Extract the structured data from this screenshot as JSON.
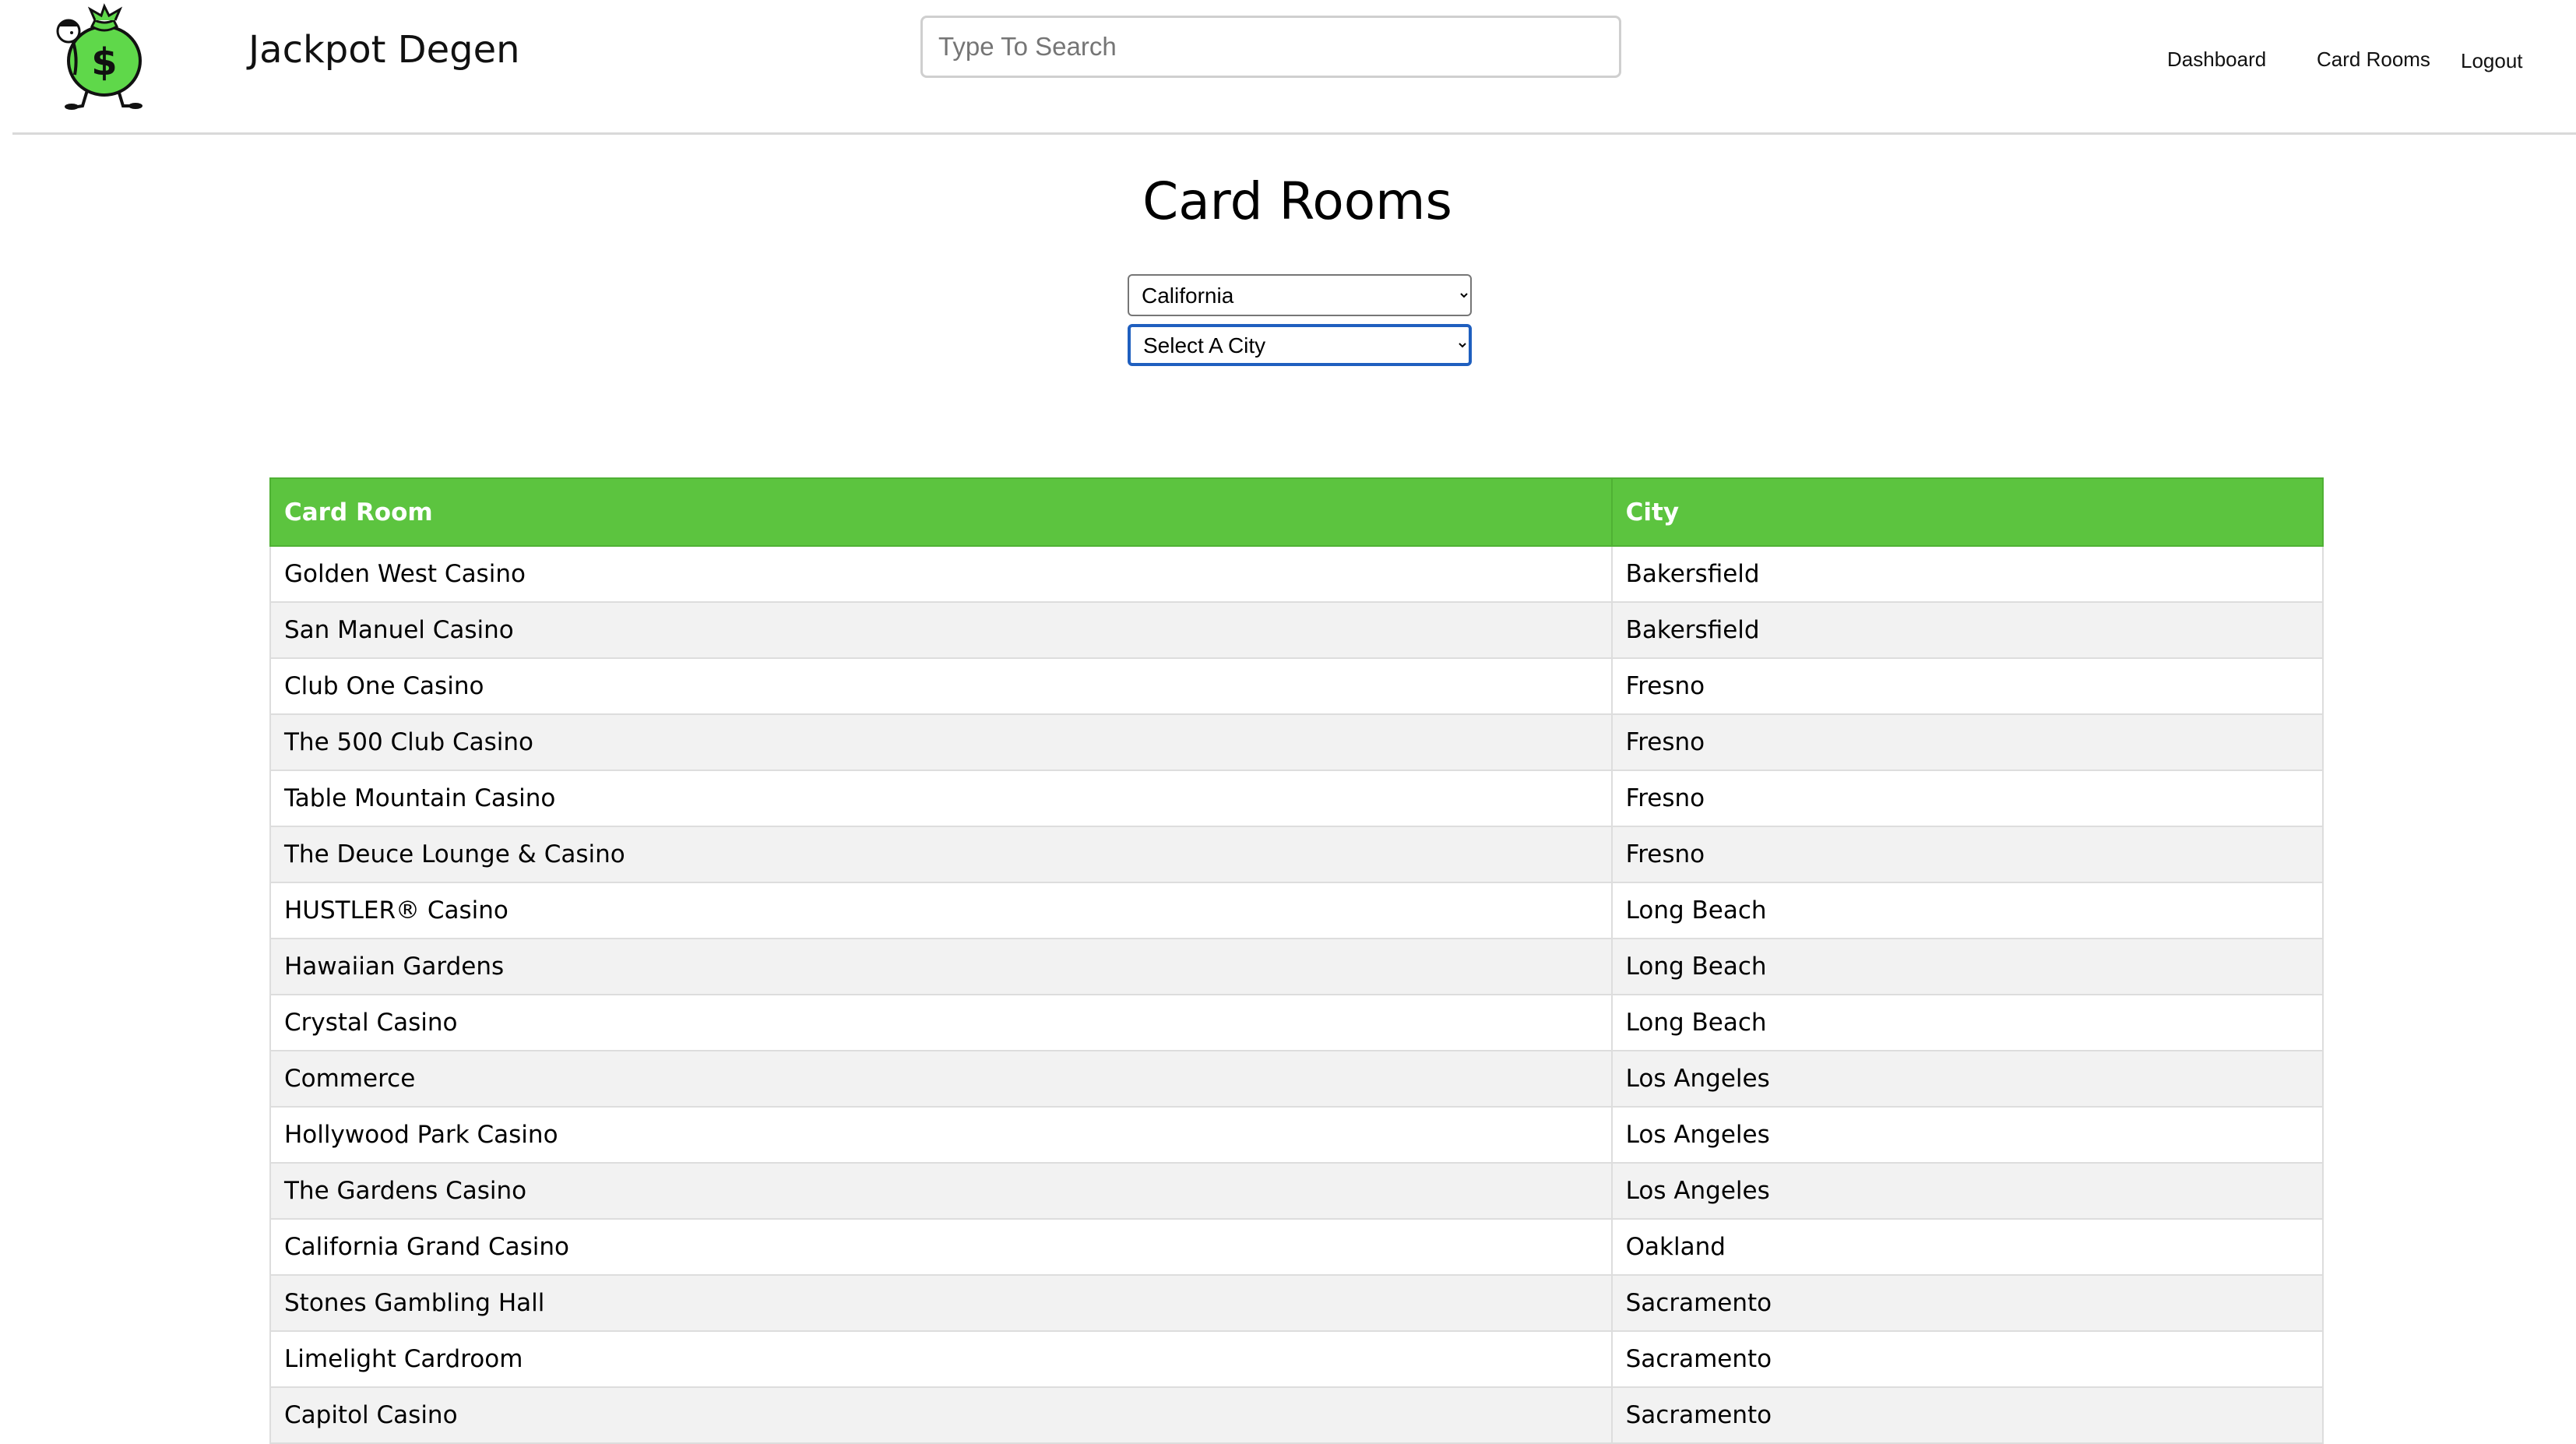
{
  "header": {
    "brand": "Jackpot Degen",
    "search_placeholder": "Type To Search",
    "nav": {
      "dashboard": "Dashboard",
      "card_rooms": "Card Rooms",
      "logout": "Logout"
    }
  },
  "main": {
    "title": "Card Rooms",
    "state_select": {
      "selected": "California"
    },
    "city_select": {
      "selected": "Select A City"
    },
    "table": {
      "columns": [
        "Card Room",
        "City"
      ],
      "rows": [
        {
          "room": "Golden West Casino",
          "city": "Bakersfield"
        },
        {
          "room": "San Manuel Casino",
          "city": "Bakersfield"
        },
        {
          "room": "Club One Casino",
          "city": "Fresno"
        },
        {
          "room": "The 500 Club Casino",
          "city": "Fresno"
        },
        {
          "room": "Table Mountain Casino",
          "city": "Fresno"
        },
        {
          "room": "The Deuce Lounge & Casino",
          "city": "Fresno"
        },
        {
          "room": "HUSTLER® Casino",
          "city": "Long Beach"
        },
        {
          "room": "Hawaiian Gardens",
          "city": "Long Beach"
        },
        {
          "room": "Crystal Casino",
          "city": "Long Beach"
        },
        {
          "room": "Commerce",
          "city": "Los Angeles"
        },
        {
          "room": "Hollywood Park Casino",
          "city": "Los Angeles"
        },
        {
          "room": "The Gardens Casino",
          "city": "Los Angeles"
        },
        {
          "room": "California Grand Casino",
          "city": "Oakland"
        },
        {
          "room": "Stones Gambling Hall",
          "city": "Sacramento"
        },
        {
          "room": "Limelight Cardroom",
          "city": "Sacramento"
        },
        {
          "room": "Capitol Casino",
          "city": "Sacramento"
        }
      ]
    }
  },
  "colors": {
    "accent_green": "#5cc43f",
    "row_stripe": "#f2f2f2",
    "focus_blue": "#1f5fbf"
  },
  "icons": {
    "logo": "money-bag-mascot-icon"
  }
}
